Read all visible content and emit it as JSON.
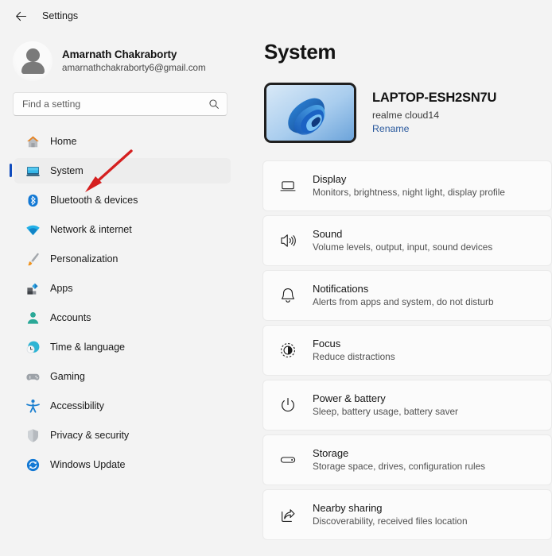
{
  "titlebar": {
    "back_label": "back-arrow",
    "title": "Settings"
  },
  "account": {
    "name": "Amarnath Chakraborty",
    "email": "amarnathchakraborty6@gmail.com",
    "avatar_icon": "person-avatar-icon"
  },
  "search": {
    "placeholder": "Find a setting",
    "value": "",
    "icon": "search-icon"
  },
  "sidebar": {
    "items": [
      {
        "label": "Home",
        "icon": "home-icon",
        "selected": false
      },
      {
        "label": "System",
        "icon": "monitor-icon",
        "selected": true
      },
      {
        "label": "Bluetooth & devices",
        "icon": "bluetooth-icon",
        "selected": false
      },
      {
        "label": "Network & internet",
        "icon": "wifi-icon",
        "selected": false
      },
      {
        "label": "Personalization",
        "icon": "paintbrush-icon",
        "selected": false
      },
      {
        "label": "Apps",
        "icon": "apps-icon",
        "selected": false
      },
      {
        "label": "Accounts",
        "icon": "person-icon",
        "selected": false
      },
      {
        "label": "Time & language",
        "icon": "clock-globe-icon",
        "selected": false
      },
      {
        "label": "Gaming",
        "icon": "gamepad-icon",
        "selected": false
      },
      {
        "label": "Accessibility",
        "icon": "accessibility-icon",
        "selected": false
      },
      {
        "label": "Privacy & security",
        "icon": "shield-icon",
        "selected": false
      },
      {
        "label": "Windows Update",
        "icon": "update-refresh-icon",
        "selected": false
      }
    ]
  },
  "main": {
    "page_title": "System",
    "device": {
      "name": "LAPTOP-ESH2SN7U",
      "model": "realme cloud14",
      "rename_label": "Rename",
      "thumbnail_icon": "windows-bloom-wallpaper"
    },
    "cards": [
      {
        "title": "Display",
        "desc": "Monitors, brightness, night light, display profile",
        "icon": "display-icon"
      },
      {
        "title": "Sound",
        "desc": "Volume levels, output, input, sound devices",
        "icon": "speaker-icon"
      },
      {
        "title": "Notifications",
        "desc": "Alerts from apps and system, do not disturb",
        "icon": "bell-icon"
      },
      {
        "title": "Focus",
        "desc": "Reduce distractions",
        "icon": "focus-icon"
      },
      {
        "title": "Power & battery",
        "desc": "Sleep, battery usage, battery saver",
        "icon": "power-icon"
      },
      {
        "title": "Storage",
        "desc": "Storage space, drives, configuration rules",
        "icon": "storage-icon"
      },
      {
        "title": "Nearby sharing",
        "desc": "Discoverability, received files location",
        "icon": "share-icon"
      }
    ]
  },
  "annotation": {
    "type": "arrow",
    "color": "#d52020",
    "points_to": "sidebar-item-system"
  },
  "colors": {
    "page_background": "#f3f3f3",
    "card_background": "#fbfbfb",
    "selection_accent": "#0f4bbd",
    "link": "#2b5a9e",
    "annotation_red": "#d52020"
  }
}
